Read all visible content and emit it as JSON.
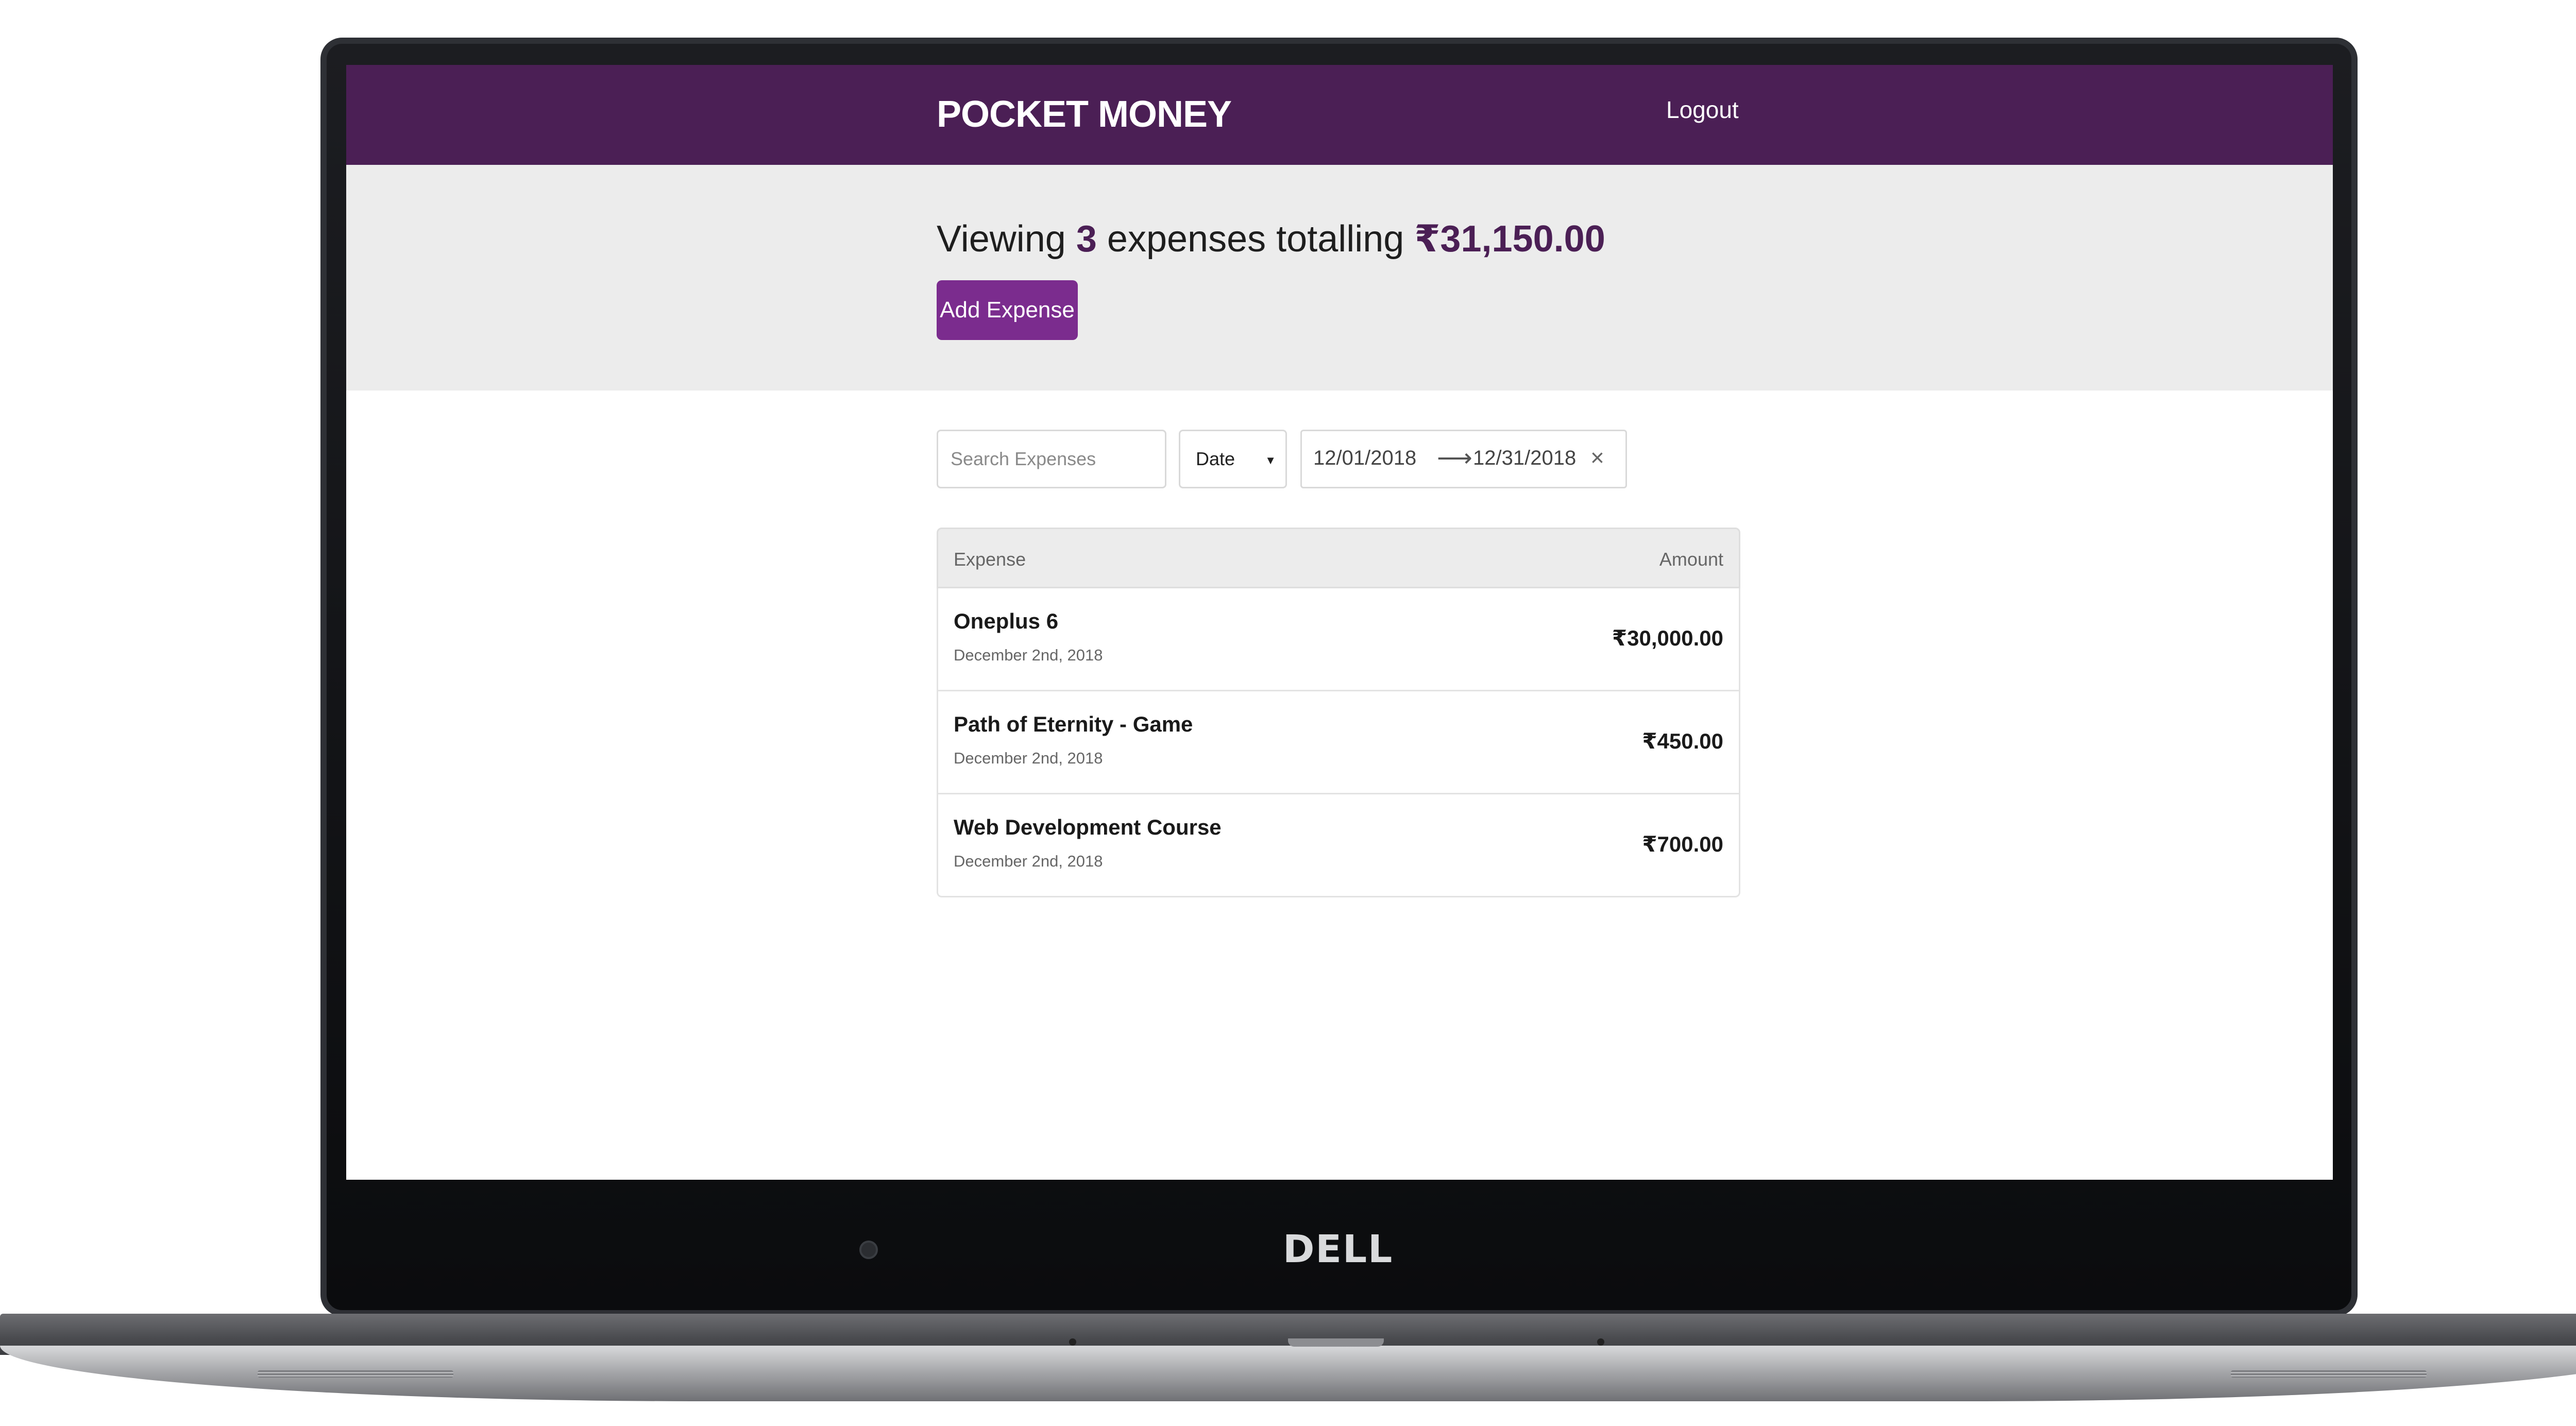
{
  "device": {
    "brand": "DELL"
  },
  "header": {
    "title": "POCKET MONEY",
    "logout_label": "Logout"
  },
  "summary": {
    "prefix": "Viewing",
    "count": "3",
    "middle": "expenses totalling",
    "total": "₹31,150.00"
  },
  "actions": {
    "add_expense_label": "Add Expense"
  },
  "filters": {
    "search_placeholder": "Search Expenses",
    "sort_by": "Date",
    "start_date": "12/01/2018",
    "end_date": "12/31/2018"
  },
  "table": {
    "headers": {
      "expense": "Expense",
      "amount": "Amount"
    },
    "rows": [
      {
        "name": "Oneplus 6",
        "date": "December 2nd, 2018",
        "amount": "₹30,000.00"
      },
      {
        "name": "Path of Eternity - Game",
        "date": "December 2nd, 2018",
        "amount": "₹450.00"
      },
      {
        "name": "Web Development Course",
        "date": "December 2nd, 2018",
        "amount": "₹700.00"
      }
    ]
  },
  "colors": {
    "header_bg": "#4b1f55",
    "accent_button": "#7b2c8e",
    "summary_band": "#ececec"
  }
}
